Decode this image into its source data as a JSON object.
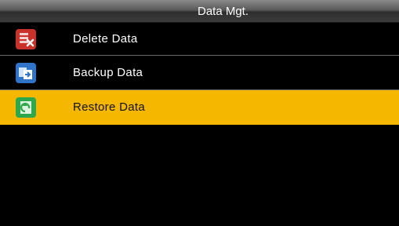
{
  "header": {
    "title": "Data Mgt."
  },
  "menu": {
    "items": [
      {
        "label": "Delete Data",
        "icon": "delete-data-icon"
      },
      {
        "label": "Backup Data",
        "icon": "backup-data-icon"
      },
      {
        "label": "Restore Data",
        "icon": "restore-data-icon",
        "selected": true
      }
    ]
  },
  "colors": {
    "background": "#000000",
    "highlight": "#f5b700",
    "delete_icon": "#d9342b",
    "backup_icon": "#2f74c9",
    "restore_icon": "#2ea84a"
  }
}
